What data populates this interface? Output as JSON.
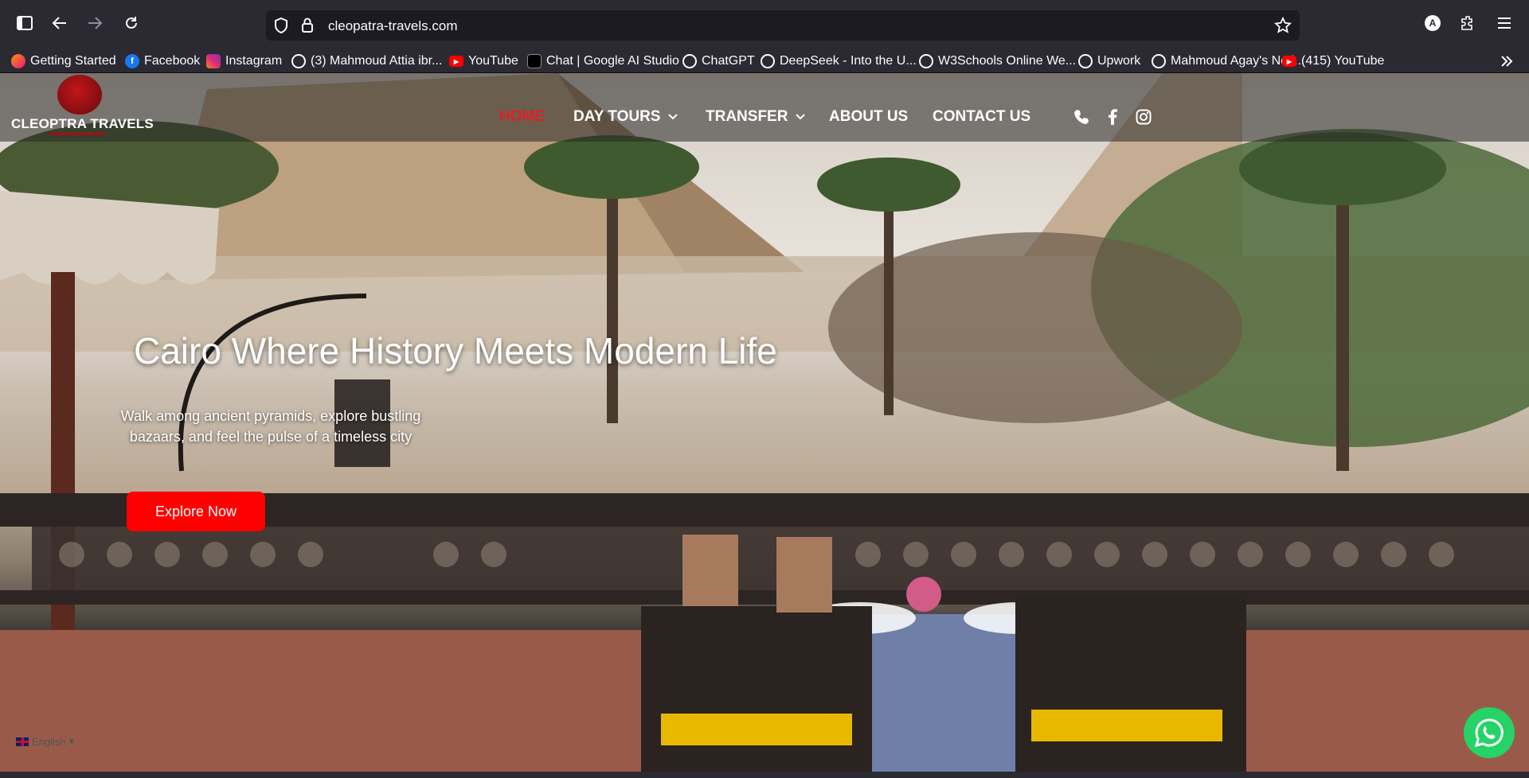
{
  "browser": {
    "url": "cleopatra-travels.com",
    "account_initial": "A",
    "bookmarks": [
      {
        "label": "Getting Started",
        "icon": "firefox-icon"
      },
      {
        "label": "Facebook",
        "icon": "facebook-icon"
      },
      {
        "label": "Instagram",
        "icon": "instagram-icon"
      },
      {
        "label": "(3) Mahmoud Attia ibr...",
        "icon": "globe-icon"
      },
      {
        "label": "YouTube",
        "icon": "youtube-icon"
      },
      {
        "label": "Chat | Google AI Studio",
        "icon": "ai-studio-icon"
      },
      {
        "label": "ChatGPT",
        "icon": "globe-icon"
      },
      {
        "label": "DeepSeek - Into the U...",
        "icon": "globe-icon"
      },
      {
        "label": "W3Schools Online We...",
        "icon": "globe-icon"
      },
      {
        "label": "Upwork",
        "icon": "globe-icon"
      },
      {
        "label": "Mahmoud Agay's Noti...",
        "icon": "globe-icon"
      },
      {
        "label": "(415) YouTube",
        "icon": "youtube-icon"
      }
    ]
  },
  "site": {
    "logo_text": "CLEOPTRA TRAVELS",
    "nav": {
      "home": "HOME",
      "day_tours": "DAY TOURS",
      "transfer": "TRANSFER",
      "about": "ABOUT US",
      "contact": "CONTACT US"
    },
    "hero": {
      "title": "Cairo Where History Meets Modern Life",
      "text": "Walk among ancient pyramids, explore bustling bazaars, and feel the pulse of a timeless city",
      "button": "Explore Now"
    },
    "language": "English"
  },
  "colors": {
    "accent_red": "#e31e24",
    "button_red": "#ff0000",
    "whatsapp_green": "#25d366"
  }
}
